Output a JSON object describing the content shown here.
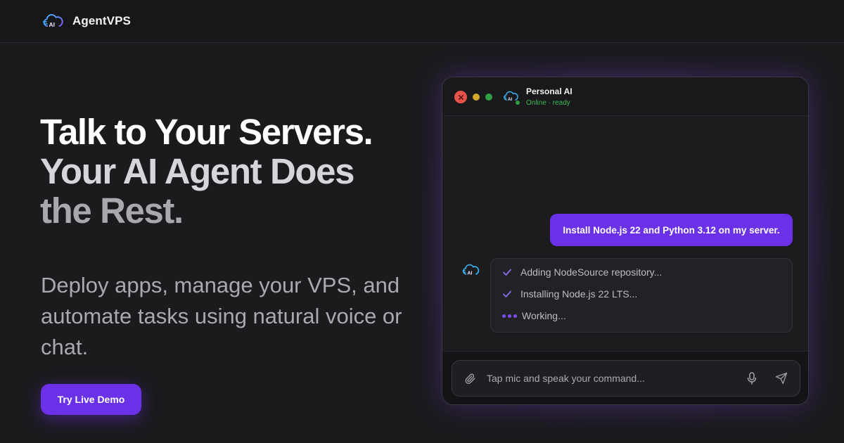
{
  "brand": {
    "name": "AgentVPS",
    "logo_icon": "cloud-ai-icon",
    "accent": "#6a31e8"
  },
  "hero": {
    "title_lines": [
      "Talk to Your Servers.",
      "Your AI Agent Does",
      "the Rest."
    ],
    "subtitle": "Deploy apps, manage your VPS, and automate tasks using natural voice or chat.",
    "cta_label": "Try Live Demo"
  },
  "demo_window": {
    "agent_name": "Personal AI",
    "agent_status": "Online · ready",
    "user_message": "Install Node.js 22 and Python 3.12 on my server.",
    "steps": [
      {
        "label": "Adding NodeSource repository...",
        "state": "done",
        "icon": "check-icon"
      },
      {
        "label": "Installing Node.js 22 LTS...",
        "state": "done",
        "icon": "check-icon"
      },
      {
        "label": "Working...",
        "state": "in-progress",
        "icon": "typing-dots-icon"
      }
    ],
    "input_placeholder": "Tap mic and speak your command...",
    "icons": [
      "paperclip-icon",
      "microphone-icon",
      "send-icon"
    ]
  }
}
